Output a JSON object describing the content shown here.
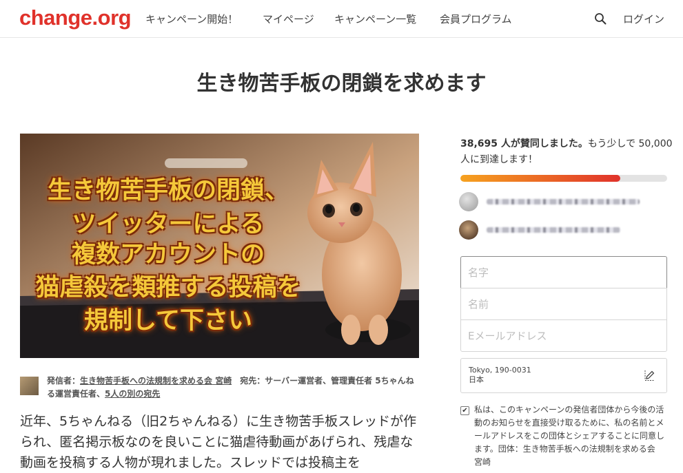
{
  "header": {
    "logo": "change.org",
    "nav": [
      "キャンペーン開始！",
      "マイページ",
      "キャンペーン一覧",
      "会員プログラム"
    ],
    "login": "ログイン",
    "search_icon": "search-icon"
  },
  "petition": {
    "title": "生き物苦手板の閉鎖を求めます",
    "image_caption": [
      "生き物苦手板の閉鎖、",
      "ツイッターによる",
      "複数アカウントの",
      "猫虐殺を類推する投稿を",
      "規制して下さい"
    ],
    "starter_label": "発信者：",
    "starter_name": "生き物苦手板への法規制を求める会 宮崎",
    "target_label": "宛先：",
    "targets": "サーバー運営者、管理責任者 5ちゃんねる運営責任者、",
    "other_targets": "5人の別の宛先",
    "body_text": "近年、5ちゃんねる（旧2ちゃんねる）に生き物苦手板スレッドが作られ、匿名掲示板なのを良いことに猫虐待動画があげられ、残虐な動画を投稿する人物が現れました。スレッドでは投稿主を"
  },
  "sidebar": {
    "count": "38,695 人が賛同しました。",
    "goal_text": "もう少しで 50,000 人に到達します！",
    "progress_fraction": 0.7739,
    "first_name_placeholder": "名字",
    "last_name_placeholder": "名前",
    "email_placeholder": "Eメールアドレス",
    "location_line1": "Tokyo, 190-0031",
    "location_line2": "日本",
    "consent_checked": true,
    "consent_text": "私は、このキャンペーンの発信者団体から今後の活動のお知らせを直接受け取るために、私の名前とメールアドレスをこの団体とシェアすることに同意します。団体：生き物苦手板への法規制を求める会 宮崎"
  },
  "colors": {
    "brand": "#e0322b",
    "progress_start": "#f6a21f",
    "progress_end": "#e0322b",
    "caption": "#f5c83a"
  }
}
